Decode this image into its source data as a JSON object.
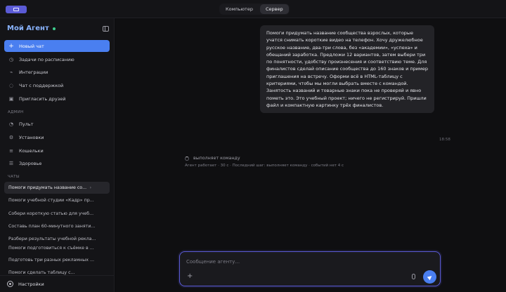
{
  "topbar": {
    "tabs": [
      {
        "label": "Компьютер",
        "active": false
      },
      {
        "label": "Сервер",
        "active": true
      }
    ]
  },
  "sidebar": {
    "brand": "Мой Агент",
    "new_chat": "Новый чат",
    "nav": [
      {
        "label": "Задачи по расписанию",
        "icon": "clock-icon"
      },
      {
        "label": "Интеграции",
        "icon": "plug-icon"
      },
      {
        "label": "Чат с поддержкой",
        "icon": "headset-icon"
      },
      {
        "label": "Пригласить друзей",
        "icon": "gift-icon"
      }
    ],
    "admin_label": "АДМИН",
    "admin": [
      {
        "label": "Пульт",
        "icon": "gauge-icon"
      },
      {
        "label": "Установки",
        "icon": "sliders-icon"
      },
      {
        "label": "Кошельки",
        "icon": "wallet-icon"
      },
      {
        "label": "Здоровье",
        "icon": "health-icon"
      }
    ],
    "chats_label": "ЧАТЫ",
    "chats": [
      "Помоги придумать название со...",
      "Помоги учебной студии «Кадр» пр...",
      "Собери короткую статью для учеб...",
      "Составь план 60-минутного заняти...",
      "Разбери результаты учебной рекла...",
      "Помоги подготовиться к съёмке в ...",
      "Подготовь три разных рекламных ...",
      "Помоги сделать таблицу с..."
    ],
    "settings": "Настройки"
  },
  "main": {
    "user_message": "Помоги придумать название сообщества взрослых, которые учатся снимать короткие видео на телефон. Хочу дружелюбное русское название, два-три слова, без «академии», «успеха» и обещаний заработка. Предложи 12 вариантов, затем выбери три по понятности, удобству произнесения и соответствию теме. Для финалистов сделай описание сообщества до 160 знаков и пример приглашения на встречу. Оформи всё в HTML-таблицу с критериями, чтобы мы могли выбрать вместе с командой. Занятость названий и товарные знаки пока не проверяй и явно пометь это. Это учебный проект; ничего не регистрируй. Пришли файл и компактную картинку трёх финалистов.",
    "message_time": "18:58",
    "status": "выполняет команду",
    "status_sub": "Агент работает · 30 с · Последний шаг: выполняет команду · событий нет 4 с"
  },
  "composer": {
    "placeholder": "Сообщение агенту..."
  },
  "colors": {
    "accent": "#4a7ff0",
    "focus": "#5b5bd6",
    "brand_text": "#8ab4ff",
    "online": "#3ecf8e"
  }
}
